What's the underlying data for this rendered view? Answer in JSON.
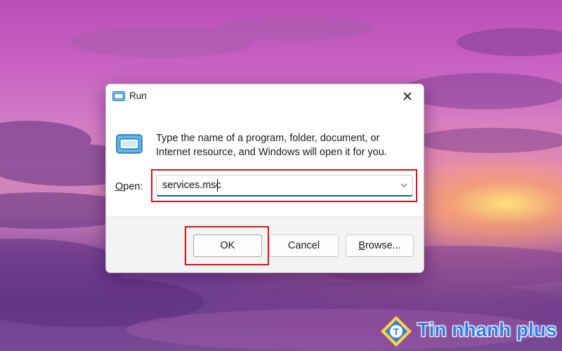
{
  "dialog": {
    "title": "Run",
    "close_label": "✕",
    "description": "Type the name of a program, folder, document, or Internet resource, and Windows will open it for you.",
    "open_label_underlined": "O",
    "open_label_rest": "pen:",
    "open_value": "services.msc",
    "buttons": {
      "ok": "OK",
      "cancel": "Cancel",
      "browse_underlined": "B",
      "browse_rest": "rowse..."
    }
  },
  "watermark": {
    "text": "Tin nhanh plus",
    "logo_letter": "T"
  },
  "colors": {
    "highlight": "#d7141c",
    "accent": "#0067c0",
    "watermark": "#2f7fe6"
  },
  "icons": [
    "run-app-icon",
    "close-icon",
    "chevron-down-icon"
  ]
}
